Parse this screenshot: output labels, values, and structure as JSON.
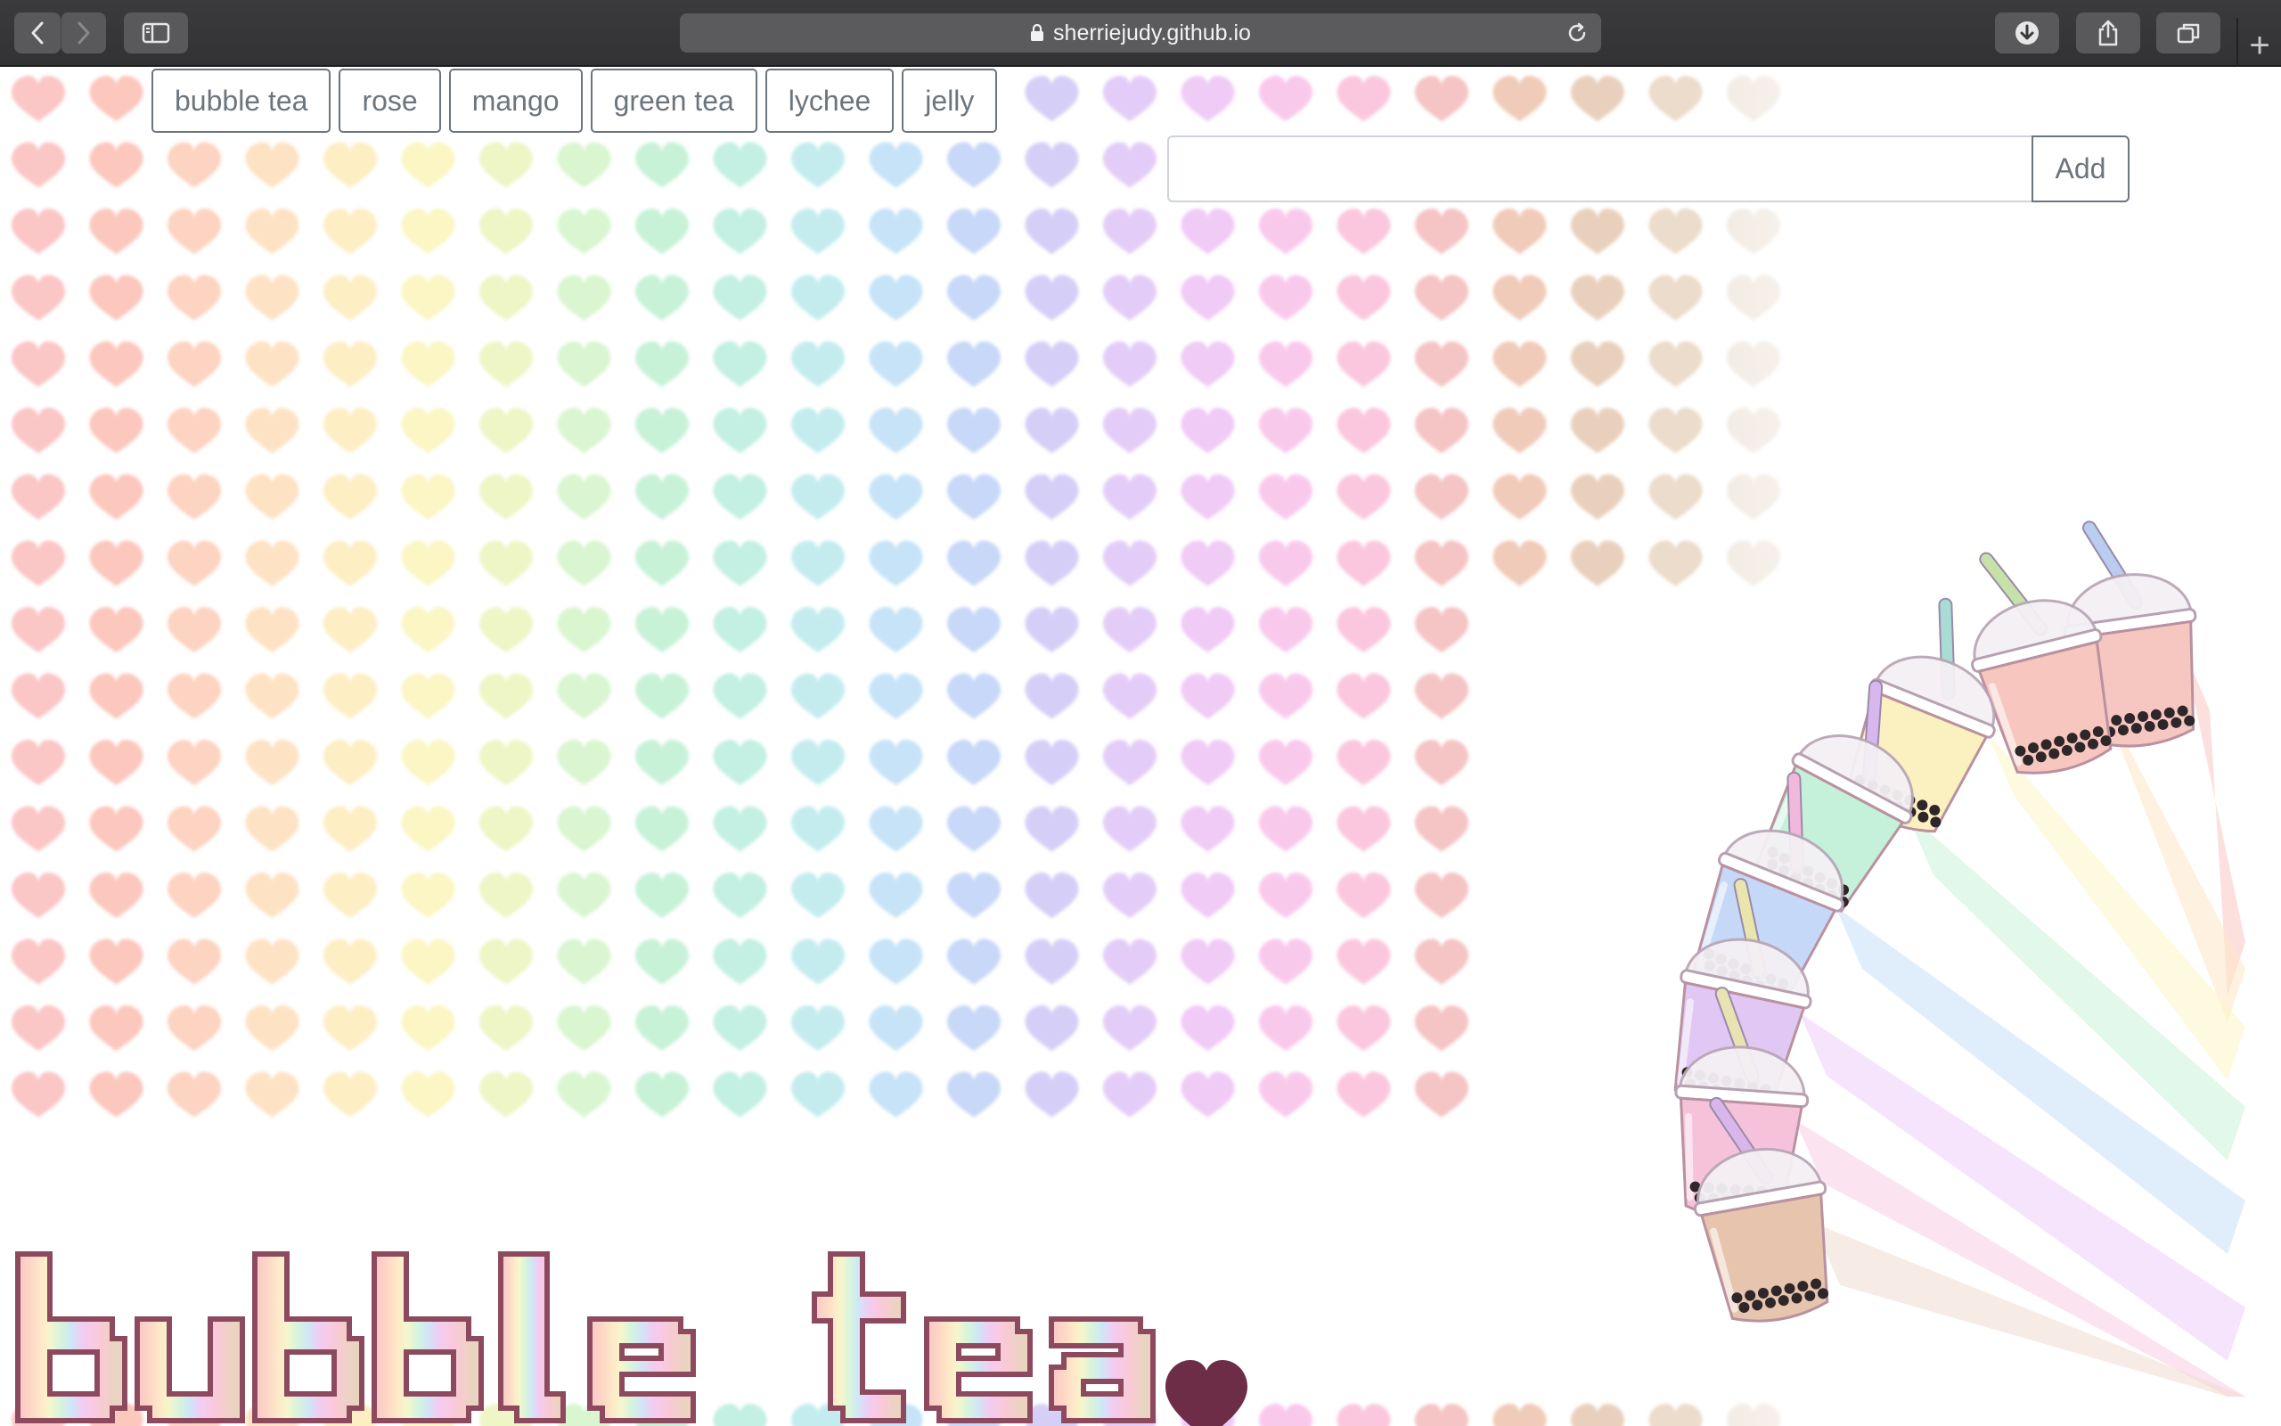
{
  "browser": {
    "url": "sherriejudy.github.io",
    "back_icon": "chevron-left-icon",
    "forward_icon": "chevron-right-icon",
    "sidebar_icon": "sidebar-icon",
    "downloads_icon": "download-icon",
    "share_icon": "share-icon",
    "tabs_icon": "tab-overview-icon",
    "new_tab_label": "+"
  },
  "flavors": {
    "items": [
      "bubble tea",
      "rose",
      "mango",
      "green tea",
      "lychee",
      "jelly"
    ]
  },
  "add_form": {
    "input_value": "",
    "button_label": "Add"
  },
  "logo": {
    "text": "bubble tea",
    "heart_color": "#6e2d46"
  },
  "colors": {
    "button_text": "#6c757d",
    "hearts": [
      "#fbc6c6",
      "#fcc7bd",
      "#fdd3c1",
      "#fee2c4",
      "#fdeec4",
      "#fbf6c4",
      "#eef6c6",
      "#d9f6d0",
      "#c8f2d8",
      "#c3f0e2",
      "#c4ecef",
      "#c6e3f8",
      "#c8d8f8",
      "#d5cff8",
      "#e3cdf8",
      "#f0cbf6",
      "#f9c9ec",
      "#fbc7de",
      "#f5c4c4",
      "#f0cbb9",
      "#e9d0bc",
      "#ecdccb",
      "#f3ece4"
    ]
  }
}
